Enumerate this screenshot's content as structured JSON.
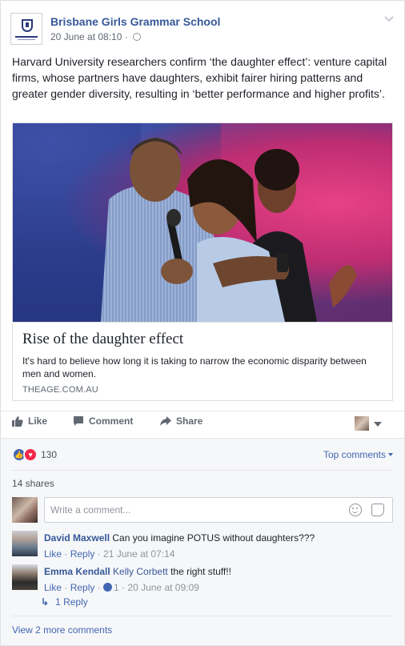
{
  "post": {
    "page_name": "Brisbane Girls Grammar School",
    "timestamp": "20 June at 08:10 ·",
    "privacy_icon": "globe-icon",
    "options_icon": "chevron-down-icon",
    "text": "Harvard University researchers confirm ‘the daughter effect’: venture capital firms, whose partners have daughters, exhibit fairer hiring patterns and greater gender diversity, resulting in ‘better performance and higher profits’."
  },
  "link": {
    "title": "Rise of the daughter effect",
    "description": "It's hard to believe how long it is taking to narrow the economic disparity between men and women.",
    "domain": "THEAGE.COM.AU"
  },
  "actions": {
    "like": "Like",
    "comment": "Comment",
    "share": "Share"
  },
  "reactions": {
    "count": "130",
    "types": [
      "like",
      "love"
    ],
    "top_comments": "Top comments",
    "shares": "14 shares"
  },
  "composer": {
    "placeholder": "Write a comment..."
  },
  "comments": [
    {
      "author": "David Maxwell",
      "tag": "",
      "text": "Can you imagine POTUS without daughters???",
      "like": "Like",
      "reply": "Reply",
      "sep1": " · ",
      "sep2": " · ",
      "time": "21 June at 07:14",
      "likes": ""
    },
    {
      "author": "Emma Kendall",
      "tag": "Kelly Corbett",
      "text": "the right stuff!!",
      "like": "Like",
      "reply": "Reply",
      "sep1": " · ",
      "sep2": " · ",
      "time": "20 June at 09:09",
      "likes": "1"
    }
  ],
  "replies_link": "1 Reply",
  "view_more": "View 2 more comments",
  "colors": {
    "link_blue": "#365899",
    "accent_blue": "#4267b2",
    "love_red": "#f0284a",
    "muted": "#90949c"
  }
}
